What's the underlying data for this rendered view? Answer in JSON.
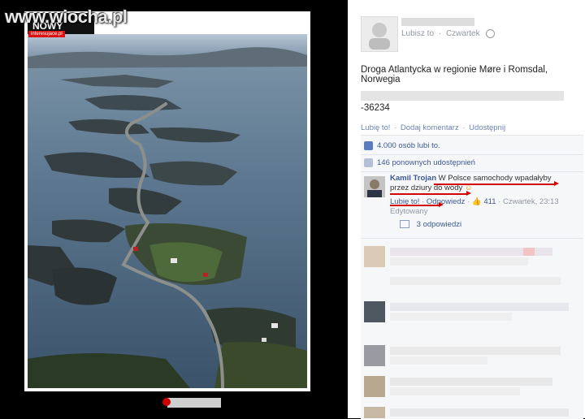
{
  "watermark": {
    "text": "www.wiocha.pl"
  },
  "photo": {
    "publisher_tag": "interesujace.pl",
    "description": "aerial photo of a winding coastal road across islands"
  },
  "post": {
    "audience_label": "Lubisz to",
    "timestamp": "Czwartek",
    "text": "Droga Atlantycka w regionie Møre i Romsdal, Norwegia",
    "number": "-36234",
    "actions": {
      "like": "Lubię to!",
      "comment": "Dodaj komentarz",
      "share": "Udostępnij"
    }
  },
  "ufi": {
    "likes": "4.000 osób lubi to.",
    "shares": "146 ponownych udostępnień",
    "comment": {
      "author": "Kamil Trojan",
      "text": "W Polsce samochody wpadałyby przez dziury do wody",
      "emoji": "☺",
      "like": "Lubię to!",
      "reply": "Odpowiedz",
      "like_count": "411",
      "time": "Czwartek, 23:13",
      "edited": "Edytowany",
      "replies": "3 odpowiedzi"
    }
  },
  "colors": {
    "link": "#3b5998",
    "annotation": "#d40000",
    "meta": "#9197a3"
  },
  "icons": [
    "globe-icon",
    "thumbs-up-icon",
    "share-icon",
    "reply-icon"
  ]
}
